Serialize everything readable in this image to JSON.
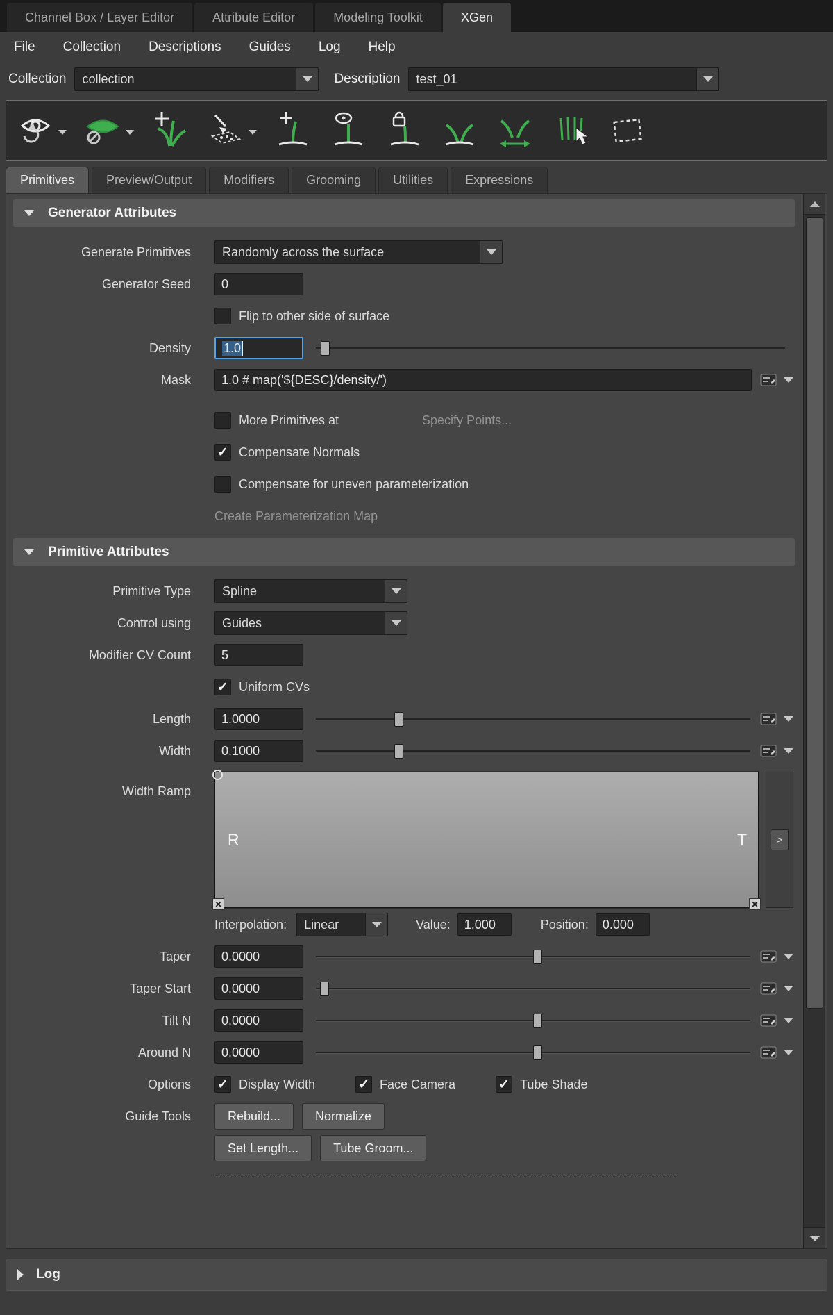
{
  "top_tabs": [
    {
      "label": "Channel Box / Layer Editor"
    },
    {
      "label": "Attribute Editor"
    },
    {
      "label": "Modeling Toolkit"
    },
    {
      "label": "XGen"
    }
  ],
  "menubar": [
    {
      "label": "File"
    },
    {
      "label": "Collection"
    },
    {
      "label": "Descriptions"
    },
    {
      "label": "Guides"
    },
    {
      "label": "Log"
    },
    {
      "label": "Help"
    }
  ],
  "collection_bar": {
    "collection_label": "Collection",
    "collection_value": "collection",
    "description_label": "Description",
    "description_value": "test_01"
  },
  "toolbar": {
    "icons": [
      "preview-refresh-icon",
      "toggle-primitive-display-icon",
      "create-description-icon",
      "export-selection-icon",
      "add-guide-icon",
      "guide-visibility-icon",
      "lock-guide-length-icon",
      "guides-display-icon",
      "guide-width-icon",
      "groom-comb-icon",
      "region-select-icon"
    ]
  },
  "panel_tabs": [
    {
      "label": "Primitives"
    },
    {
      "label": "Preview/Output"
    },
    {
      "label": "Modifiers"
    },
    {
      "label": "Grooming"
    },
    {
      "label": "Utilities"
    },
    {
      "label": "Expressions"
    }
  ],
  "generator_attributes": {
    "title": "Generator Attributes",
    "generate_primitives_label": "Generate Primitives",
    "generate_primitives_value": "Randomly across the surface",
    "generator_seed_label": "Generator Seed",
    "generator_seed_value": "0",
    "flip_label": "Flip to other side of surface",
    "flip_checked": false,
    "density_label": "Density",
    "density_value": "1.0",
    "mask_label": "Mask",
    "mask_value": "1.0 # map('${DESC}/density/')",
    "more_primitives_label": "More Primitives at",
    "more_primitives_checked": false,
    "specify_points_label": "Specify Points...",
    "compensate_normals_label": "Compensate Normals",
    "compensate_normals_checked": true,
    "compensate_uneven_label": "Compensate for uneven parameterization",
    "compensate_uneven_checked": false,
    "create_param_map_label": "Create Parameterization Map"
  },
  "primitive_attributes": {
    "title": "Primitive Attributes",
    "primitive_type_label": "Primitive Type",
    "primitive_type_value": "Spline",
    "control_using_label": "Control using",
    "control_using_value": "Guides",
    "modifier_cv_count_label": "Modifier CV Count",
    "modifier_cv_count_value": "5",
    "uniform_cvs_label": "Uniform CVs",
    "uniform_cvs_checked": true,
    "length_label": "Length",
    "length_value": "1.0000",
    "width_label": "Width",
    "width_value": "0.1000",
    "width_ramp_label": "Width Ramp",
    "ramp_left_marker": "R",
    "ramp_right_marker": "T",
    "ramp_expand_label": ">",
    "interpolation_label": "Interpolation:",
    "interpolation_value": "Linear",
    "value_label": "Value:",
    "value_value": "1.000",
    "position_label": "Position:",
    "position_value": "0.000",
    "taper_label": "Taper",
    "taper_value": "0.0000",
    "taper_start_label": "Taper Start",
    "taper_start_value": "0.0000",
    "tilt_n_label": "Tilt N",
    "tilt_n_value": "0.0000",
    "around_n_label": "Around N",
    "around_n_value": "0.0000",
    "options_label": "Options",
    "display_width_label": "Display Width",
    "display_width_checked": true,
    "face_camera_label": "Face Camera",
    "face_camera_checked": true,
    "tube_shade_label": "Tube Shade",
    "tube_shade_checked": true,
    "guide_tools_label": "Guide Tools",
    "rebuild_label": "Rebuild...",
    "normalize_label": "Normalize",
    "set_length_label": "Set Length...",
    "tube_groom_label": "Tube Groom..."
  },
  "log_section": {
    "label": "Log"
  },
  "colors": {
    "xgen_green": "#3fae4f",
    "focus_blue": "#57a3e4"
  }
}
